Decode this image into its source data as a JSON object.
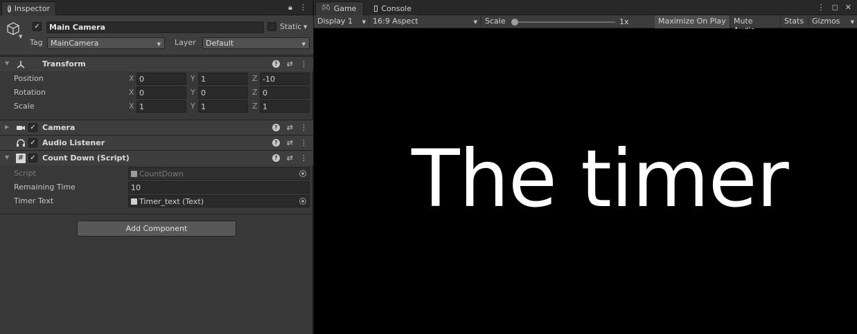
{
  "inspector": {
    "tab_label": "Inspector",
    "lock_icon": "lock-icon",
    "menu_icon": "kebab-menu-icon",
    "gameobject": {
      "active_check": "✓",
      "name": "Main Camera",
      "static_label": "Static",
      "tag_label": "Tag",
      "tag_value": "MainCamera",
      "layer_label": "Layer",
      "layer_value": "Default"
    },
    "transform": {
      "title": "Transform",
      "rows": [
        {
          "label": "Position",
          "x": "0",
          "y": "1",
          "z": "-10"
        },
        {
          "label": "Rotation",
          "x": "0",
          "y": "0",
          "z": "0"
        },
        {
          "label": "Scale",
          "x": "1",
          "y": "1",
          "z": "1"
        }
      ],
      "axis_x": "X",
      "axis_y": "Y",
      "axis_z": "Z"
    },
    "components": {
      "camera": {
        "title": "Camera",
        "check": "✓"
      },
      "audio_listener": {
        "title": "Audio Listener",
        "check": "✓"
      },
      "countdown": {
        "title": "Count Down (Script)",
        "check": "✓",
        "script_label": "Script",
        "script_value": "CountDown",
        "remaining_label": "Remaining Time",
        "remaining_value": "10",
        "timer_label": "Timer Text",
        "timer_value": "Timer_text (Text)"
      }
    },
    "add_component_label": "Add Component"
  },
  "game": {
    "tab_game": "Game",
    "tab_console": "Console",
    "toolbar": {
      "display": "Display 1",
      "aspect": "16:9 Aspect",
      "scale_label": "Scale",
      "scale_value": "1x",
      "maximize": "Maximize On Play",
      "mute": "Mute Audio",
      "stats": "Stats",
      "gizmos": "Gizmos"
    },
    "timer_text": "The timer"
  },
  "colors": {
    "panel_bg": "#383838",
    "header_bg": "#3e3e3e",
    "field_bg": "#2a2a2a",
    "viewport_bg": "#000000",
    "timer_text": "#ffffff"
  }
}
